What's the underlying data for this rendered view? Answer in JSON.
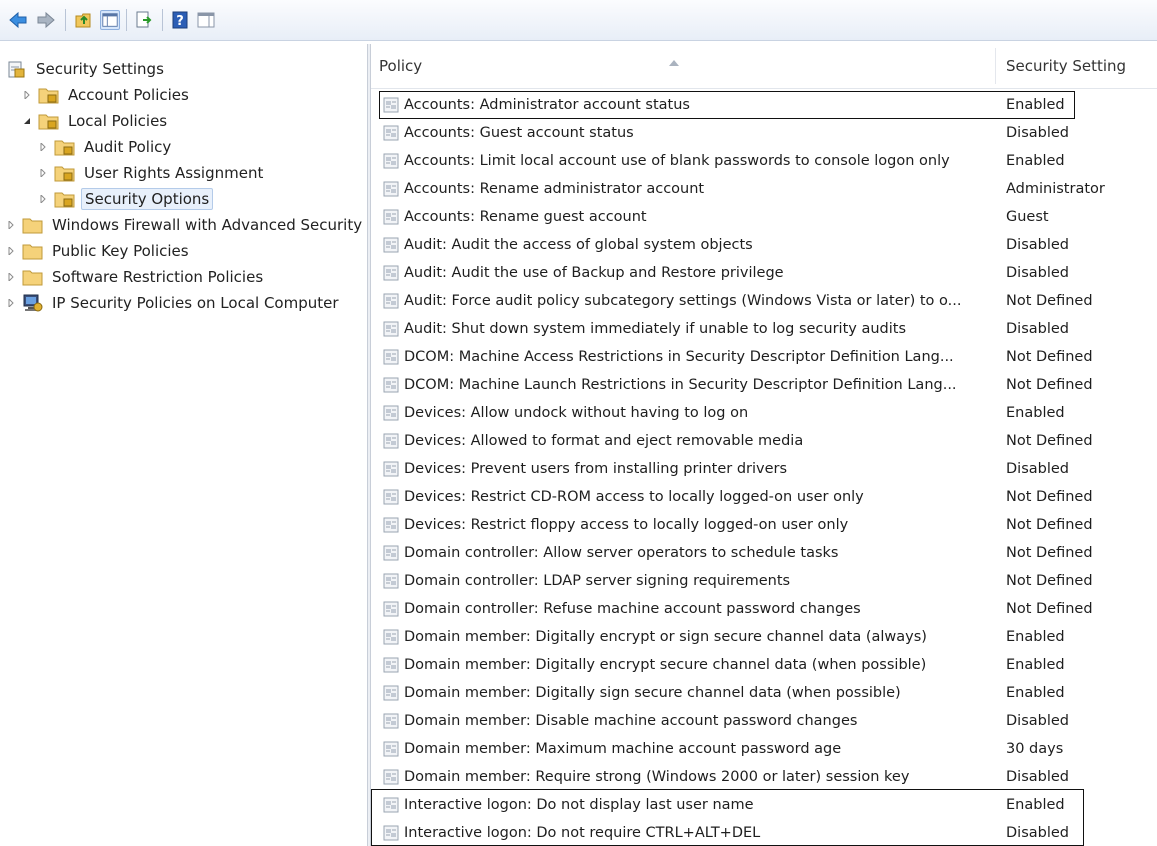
{
  "tree": {
    "nodes": [
      {
        "label": "Security Settings"
      },
      {
        "label": "Account Policies"
      },
      {
        "label": "Local Policies"
      },
      {
        "label": "Audit Policy"
      },
      {
        "label": "User Rights Assignment"
      },
      {
        "label": "Security Options"
      },
      {
        "label": "Windows Firewall with Advanced Security"
      },
      {
        "label": "Public Key Policies"
      },
      {
        "label": "Software Restriction Policies"
      },
      {
        "label": "IP Security Policies on Local Computer"
      }
    ]
  },
  "list": {
    "columns": {
      "policy": "Policy",
      "setting": "Security Setting"
    },
    "rows": [
      {
        "policy": "Accounts: Administrator account status",
        "setting": "Enabled"
      },
      {
        "policy": "Accounts: Guest account status",
        "setting": "Disabled"
      },
      {
        "policy": "Accounts: Limit local account use of blank passwords to console logon only",
        "setting": "Enabled"
      },
      {
        "policy": "Accounts: Rename administrator account",
        "setting": "Administrator"
      },
      {
        "policy": "Accounts: Rename guest account",
        "setting": "Guest"
      },
      {
        "policy": "Audit: Audit the access of global system objects",
        "setting": "Disabled"
      },
      {
        "policy": "Audit: Audit the use of Backup and Restore privilege",
        "setting": "Disabled"
      },
      {
        "policy": "Audit: Force audit policy subcategory settings (Windows Vista or later) to o...",
        "setting": "Not Defined"
      },
      {
        "policy": "Audit: Shut down system immediately if unable to log security audits",
        "setting": "Disabled"
      },
      {
        "policy": "DCOM: Machine Access Restrictions in Security Descriptor Definition Lang...",
        "setting": "Not Defined"
      },
      {
        "policy": "DCOM: Machine Launch Restrictions in Security Descriptor Definition Lang...",
        "setting": "Not Defined"
      },
      {
        "policy": "Devices: Allow undock without having to log on",
        "setting": "Enabled"
      },
      {
        "policy": "Devices: Allowed to format and eject removable media",
        "setting": "Not Defined"
      },
      {
        "policy": "Devices: Prevent users from installing printer drivers",
        "setting": "Disabled"
      },
      {
        "policy": "Devices: Restrict CD-ROM access to locally logged-on user only",
        "setting": "Not Defined"
      },
      {
        "policy": "Devices: Restrict floppy access to locally logged-on user only",
        "setting": "Not Defined"
      },
      {
        "policy": "Domain controller: Allow server operators to schedule tasks",
        "setting": "Not Defined"
      },
      {
        "policy": "Domain controller: LDAP server signing requirements",
        "setting": "Not Defined"
      },
      {
        "policy": "Domain controller: Refuse machine account password changes",
        "setting": "Not Defined"
      },
      {
        "policy": "Domain member: Digitally encrypt or sign secure channel data (always)",
        "setting": "Enabled"
      },
      {
        "policy": "Domain member: Digitally encrypt secure channel data (when possible)",
        "setting": "Enabled"
      },
      {
        "policy": "Domain member: Digitally sign secure channel data (when possible)",
        "setting": "Enabled"
      },
      {
        "policy": "Domain member: Disable machine account password changes",
        "setting": "Disabled"
      },
      {
        "policy": "Domain member: Maximum machine account password age",
        "setting": "30 days"
      },
      {
        "policy": "Domain member: Require strong (Windows 2000 or later) session key",
        "setting": "Disabled"
      },
      {
        "policy": "Interactive logon: Do not display last user name",
        "setting": "Enabled"
      },
      {
        "policy": "Interactive logon: Do not require CTRL+ALT+DEL",
        "setting": "Disabled"
      }
    ]
  }
}
